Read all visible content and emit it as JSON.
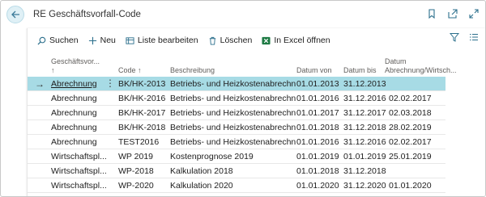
{
  "header": {
    "title": "RE Geschäftsvorfall-Code"
  },
  "toolbar": {
    "search": "Suchen",
    "new": "Neu",
    "edit_list": "Liste bearbeiten",
    "delete": "Löschen",
    "excel": "In Excel öffnen"
  },
  "columns": {
    "c1": "Geschäftsvor...",
    "c1_sort": "↑",
    "c2": "Code ↑",
    "c3": "Beschreibung",
    "c4": "Datum von",
    "c5": "Datum bis",
    "c6a": "Datum",
    "c6b": "Abrechnung/Wirtsch..."
  },
  "rows": [
    {
      "c1": "Abrechnung",
      "c2": "BK/HK-2013",
      "c3": "Betriebs- und Heizkostenabrechnung...",
      "c4": "01.01.2013",
      "c5": "31.12.2013",
      "c6": ""
    },
    {
      "c1": "Abrechnung",
      "c2": "BK/HK-2016",
      "c3": "Betriebs- und Heizkostenabrechnung...",
      "c4": "01.01.2016",
      "c5": "31.12.2016",
      "c6": "02.02.2017"
    },
    {
      "c1": "Abrechnung",
      "c2": "BK/HK-2017",
      "c3": "Betriebs- und Heizkostenabrechnung...",
      "c4": "01.01.2017",
      "c5": "31.12.2017",
      "c6": "02.03.2018"
    },
    {
      "c1": "Abrechnung",
      "c2": "BK/HK-2018",
      "c3": "Betriebs- und Heizkostenabrechnung...",
      "c4": "01.01.2018",
      "c5": "31.12.2018",
      "c6": "28.02.2019"
    },
    {
      "c1": "Abrechnung",
      "c2": "TEST2016",
      "c3": "Betriebs- und Heizkostenabrechnung...",
      "c4": "01.01.2016",
      "c5": "31.12.2016",
      "c6": "02.02.2017"
    },
    {
      "c1": "Wirtschaftspl...",
      "c2": "WP 2019",
      "c3": "Kostenprognose 2019",
      "c4": "01.01.2019",
      "c5": "01.01.2019",
      "c6": "25.01.2019"
    },
    {
      "c1": "Wirtschaftspl...",
      "c2": "WP-2018",
      "c3": "Kalkulation 2018",
      "c4": "01.01.2018",
      "c5": "31.12.2018",
      "c6": ""
    },
    {
      "c1": "Wirtschaftspl...",
      "c2": "WP-2020",
      "c3": "Kalkulation 2020",
      "c4": "01.01.2020",
      "c5": "31.12.2020",
      "c6": "01.01.2020"
    }
  ]
}
